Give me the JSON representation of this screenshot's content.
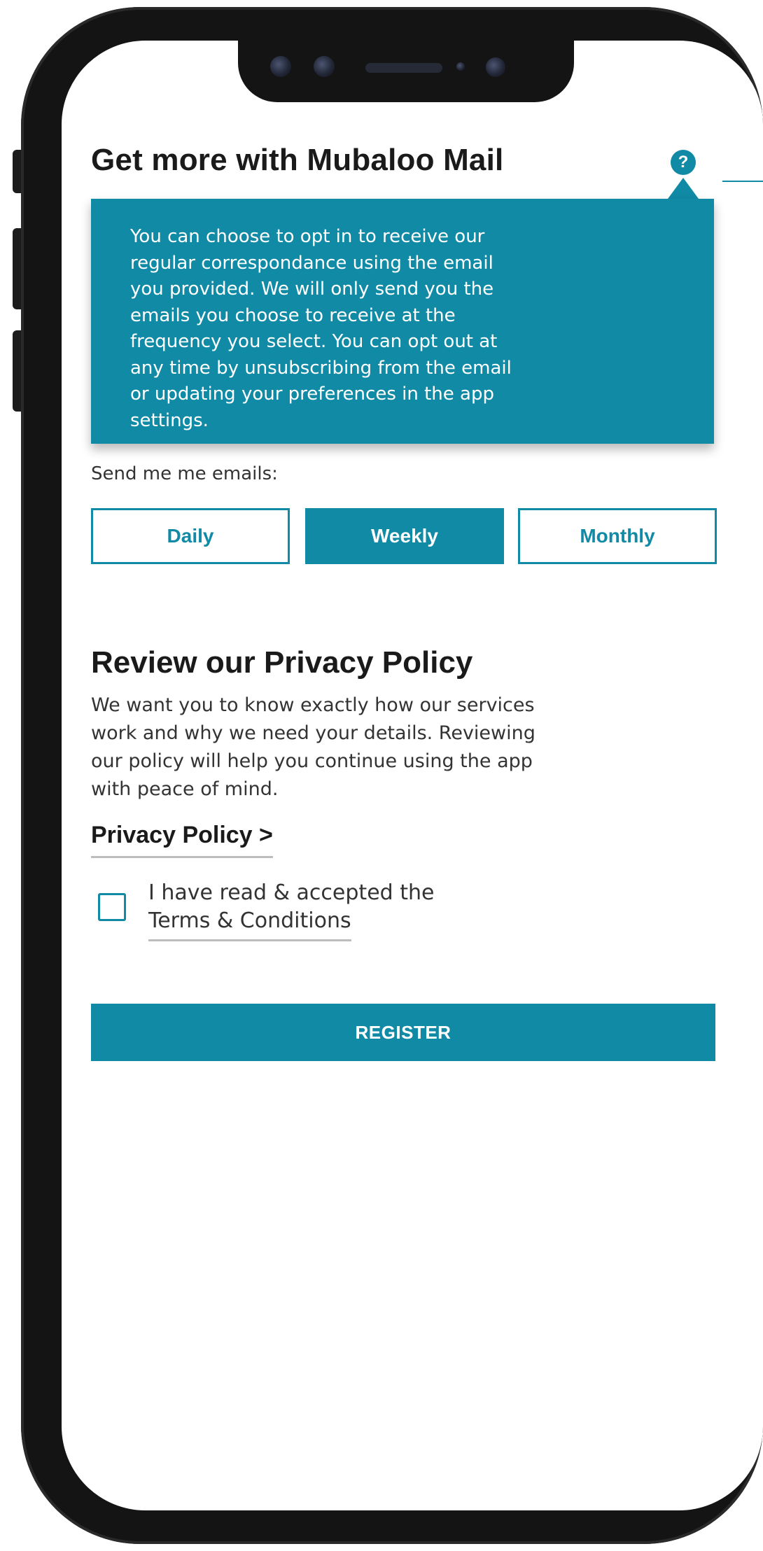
{
  "mail_section": {
    "heading": "Get more with Mubaloo Mail",
    "help_icon_glyph": "?",
    "tooltip_lines": [
      "You can choose to opt in to receive our",
      "regular correspondance using the email",
      "you provided. We will only send you the",
      "emails you choose to receive at the",
      "frequency you select. You can opt out at",
      "any time by unsubscribing from the email",
      "or updating your preferences in the app",
      "settings."
    ],
    "frequency_label": "Send me me emails:",
    "frequency_options": [
      {
        "label": "Daily",
        "selected": false
      },
      {
        "label": "Weekly",
        "selected": true
      },
      {
        "label": "Monthly",
        "selected": false
      }
    ]
  },
  "privacy_section": {
    "heading": "Review our Privacy Policy",
    "description_lines": [
      "We want you to know exactly how our services",
      "work and why we need your details. Reviewing",
      "our policy will help you continue using the app",
      "with peace of mind."
    ],
    "link_label": "Privacy Policy >"
  },
  "terms": {
    "checked": false,
    "text": "I have read & accepted the",
    "link_label": "Terms & Conditions"
  },
  "register_label": "REGISTER",
  "colors": {
    "accent": "#118aa6",
    "text_dark": "#1a1a1a",
    "text_body": "#333333",
    "frame": "#141414"
  }
}
